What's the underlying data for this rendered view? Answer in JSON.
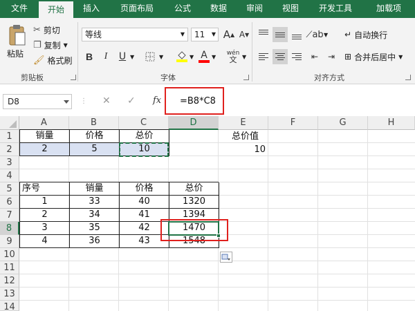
{
  "tabs": [
    "文件",
    "开始",
    "插入",
    "页面布局",
    "公式",
    "数据",
    "审阅",
    "视图",
    "开发工具",
    "加载项"
  ],
  "ribbon": {
    "clipboard": {
      "paste": "粘贴",
      "cut": "剪切",
      "copy": "复制",
      "painter": "格式刷",
      "label": "剪贴板"
    },
    "font": {
      "name": "等线",
      "size": "11",
      "bold": "B",
      "italic": "I",
      "underline": "U",
      "grow": "A",
      "shrink": "A",
      "fontcolor": "A",
      "phonetic": "wén",
      "label": "字体",
      "fill_color": "#ffff00",
      "font_color": "#ff0000"
    },
    "alignment": {
      "wrap": "自动换行",
      "merge": "合并后居中",
      "label": "对齐方式"
    }
  },
  "formula_bar": {
    "name_box": "D8",
    "formula": "=B8*C8",
    "fx": "fx",
    "cancel": "✕",
    "enter": "✓"
  },
  "columns": [
    "A",
    "B",
    "C",
    "D",
    "E",
    "F",
    "G",
    "H"
  ],
  "rows": [
    "1",
    "2",
    "3",
    "4",
    "5",
    "6",
    "7",
    "8",
    "9",
    "10",
    "11",
    "12",
    "13",
    "14"
  ],
  "top_table": {
    "headers": [
      "销量",
      "价格",
      "总价"
    ],
    "values": [
      "2",
      "5",
      "10"
    ]
  },
  "side": {
    "label": "总价值",
    "value": "10"
  },
  "main_table": {
    "headers": [
      "序号",
      "销量",
      "价格",
      "总价"
    ],
    "rows": [
      [
        "1",
        "33",
        "40",
        "1320"
      ],
      [
        "2",
        "34",
        "41",
        "1394"
      ],
      [
        "3",
        "35",
        "42",
        "1470"
      ],
      [
        "4",
        "36",
        "43",
        "1548"
      ]
    ]
  },
  "colors": {
    "excel_green": "#217346",
    "annotation_red": "#e0201d",
    "selection_blue": "#d9e1f2"
  }
}
